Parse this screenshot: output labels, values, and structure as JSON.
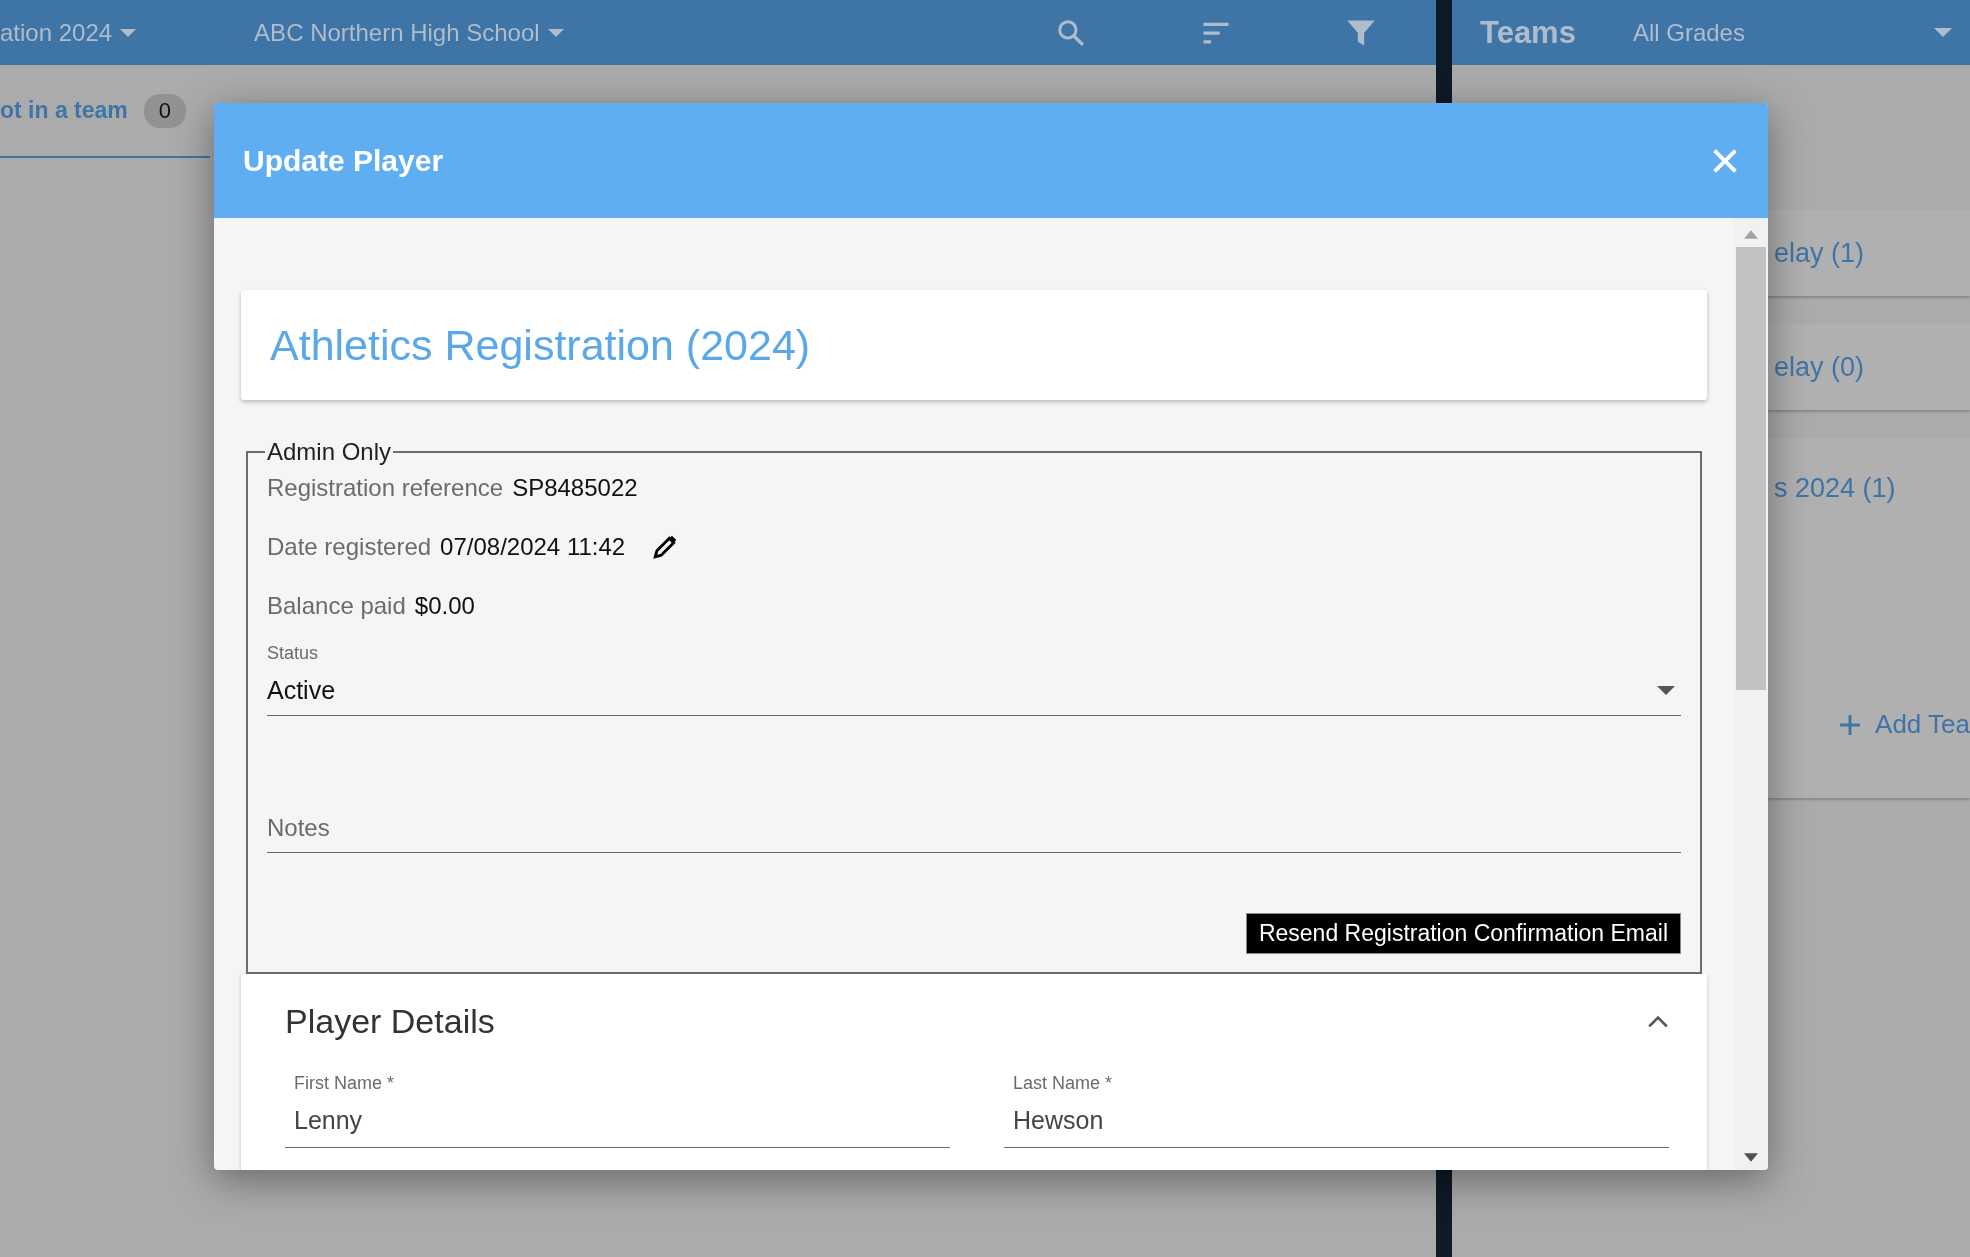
{
  "topbar": {
    "event": "ation 2024",
    "school": "ABC Northern High School"
  },
  "teams_bar": {
    "title": "Teams",
    "grade_filter": "All Grades"
  },
  "unassigned_tab": {
    "label": "ot in a team",
    "count": "0"
  },
  "team_cards": [
    "elay (1)",
    "elay (0)",
    "s 2024 (1)"
  ],
  "add_team": "Add Tea",
  "dialog": {
    "title": "Update Player",
    "registration": {
      "title": "Athletics Registration (2024)"
    },
    "admin": {
      "legend": "Admin Only",
      "fields": [
        {
          "label": "Registration reference",
          "value": "SP8485022",
          "editable": false
        },
        {
          "label": "Date registered",
          "value": "07/08/2024 11:42",
          "editable": true
        },
        {
          "label": "Balance paid",
          "value": "$0.00",
          "editable": false
        }
      ],
      "status": {
        "label": "Status",
        "value": "Active"
      },
      "notes": {
        "placeholder": "Notes"
      },
      "resend_button": "Resend Registration Confirmation Email"
    },
    "player_details": {
      "title": "Player Details",
      "expanded": true,
      "fields": [
        {
          "label": "First Name *",
          "value": "Lenny"
        },
        {
          "label": "Last Name *",
          "value": "Hewson"
        }
      ]
    }
  }
}
